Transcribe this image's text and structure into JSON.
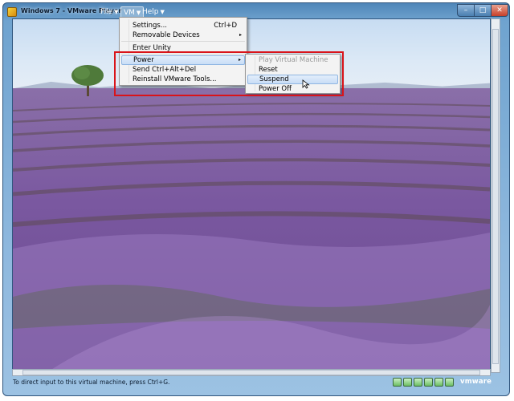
{
  "window": {
    "title": "Windows 7 - VMware Player",
    "caption_buttons": {
      "minimize": "–",
      "maximize": "□",
      "close": "✕"
    }
  },
  "menubar": {
    "file": "File",
    "vm": "VM",
    "help": "Help"
  },
  "vm_menu": {
    "items": [
      {
        "label": "Settings...",
        "shortcut": "Ctrl+D"
      },
      {
        "label": "Removable Devices",
        "submenu": "▸"
      },
      {
        "label": "Enter Unity"
      },
      {
        "label": "Power",
        "submenu": "▸"
      },
      {
        "label": "Send Ctrl+Alt+Del"
      },
      {
        "label": "Reinstall VMware Tools..."
      }
    ]
  },
  "power_menu": {
    "items": [
      {
        "label": "Play Virtual Machine",
        "enabled": false
      },
      {
        "label": "Reset"
      },
      {
        "label": "Suspend",
        "highlighted": true
      },
      {
        "label": "Power Off"
      }
    ]
  },
  "statusbar": {
    "text": "To direct input to this virtual machine, press Ctrl+G.",
    "brand": "vmware"
  },
  "colors": {
    "highlight_box": "#d9141a",
    "menu_selection": "#c8ddf6",
    "lavender": "#7b5e9c"
  },
  "icons": [
    "app-icon",
    "chevron-down-icon",
    "submenu-arrow-icon",
    "mouse-cursor-icon",
    "device-tray-icon"
  ]
}
